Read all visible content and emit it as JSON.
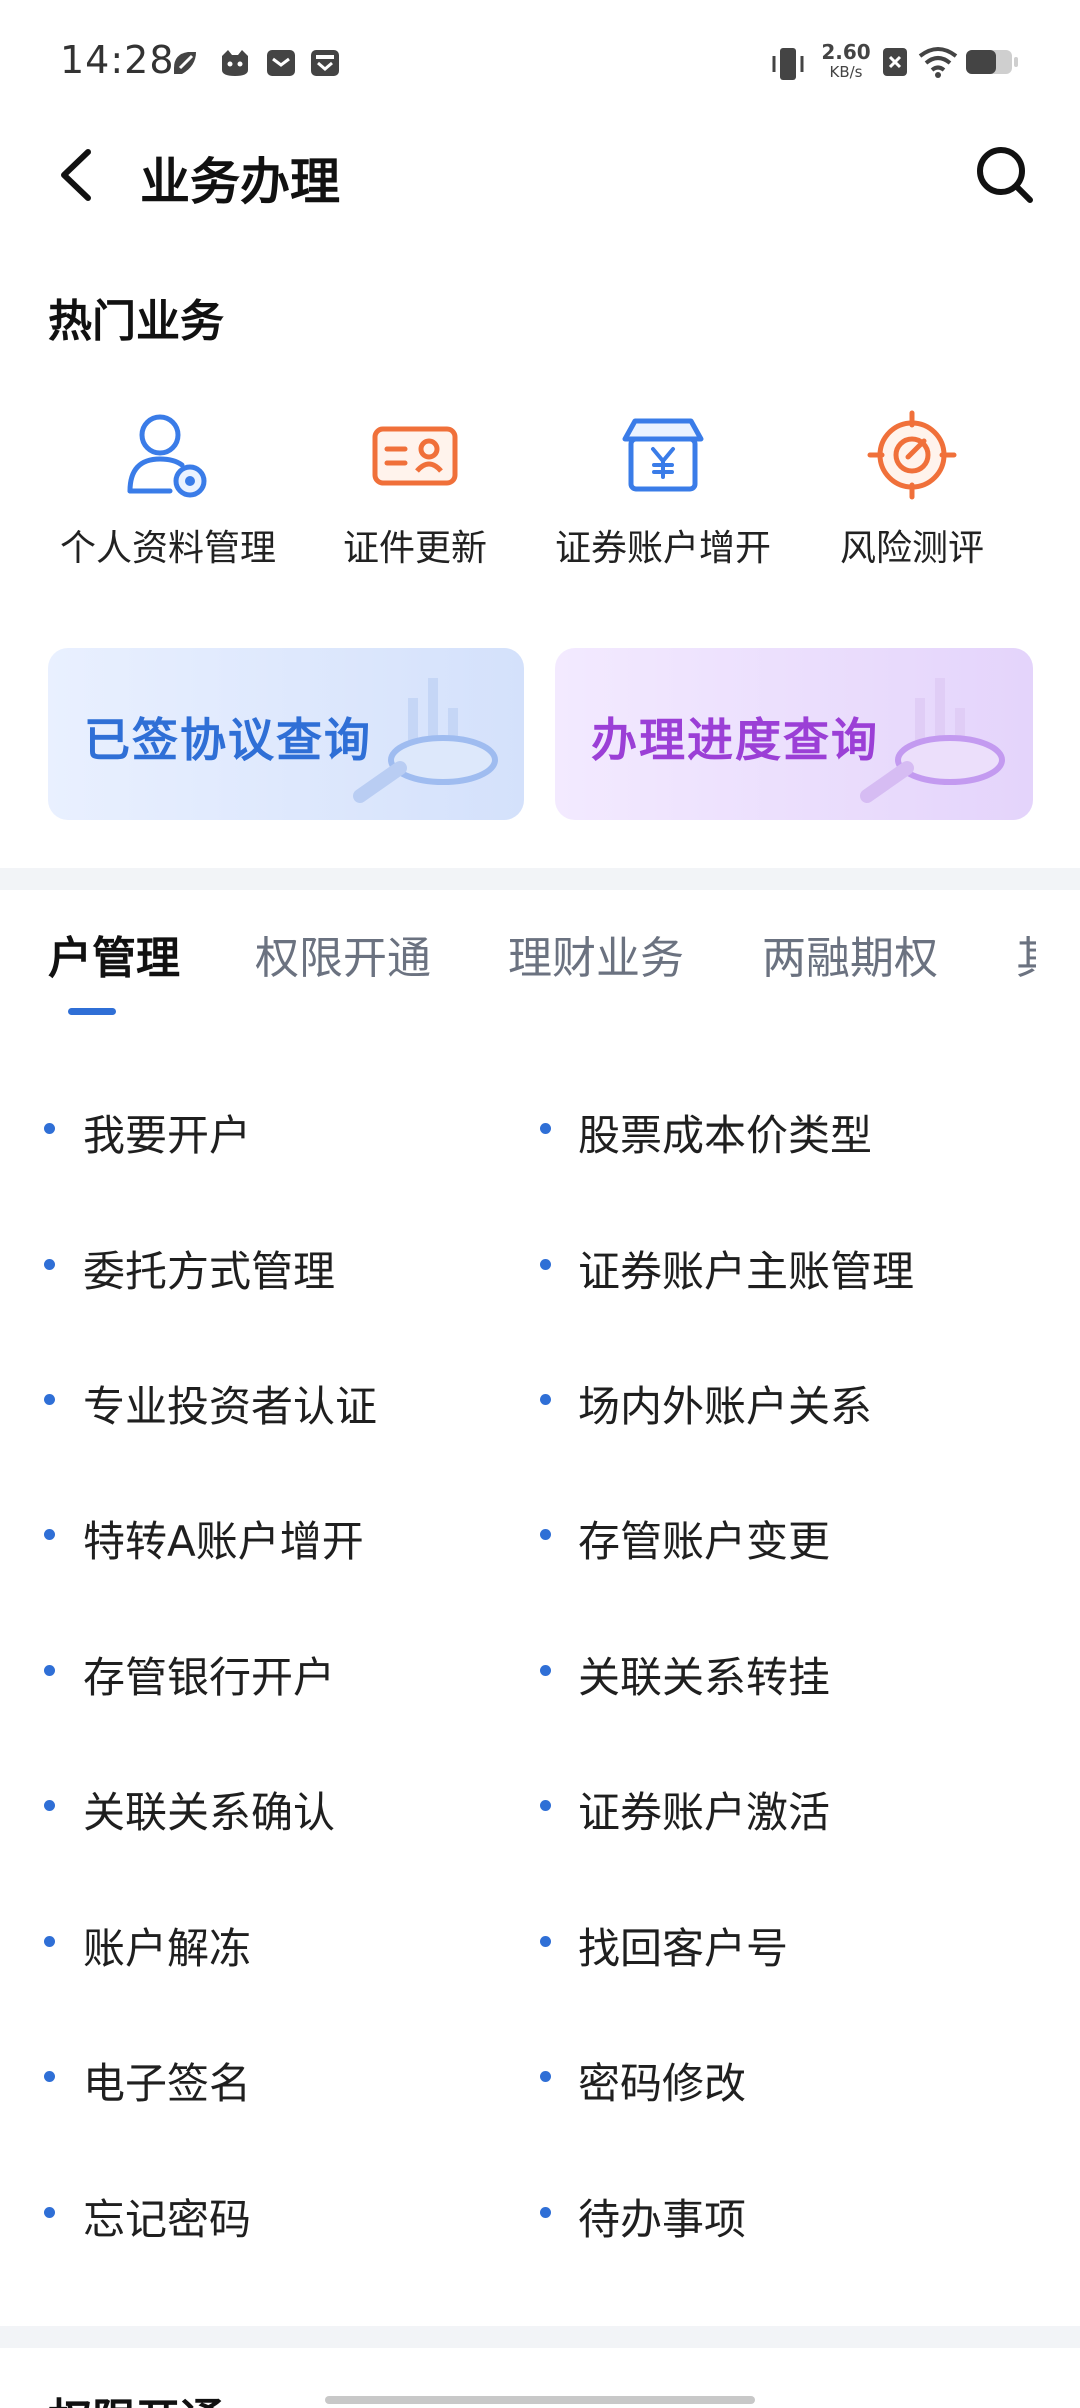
{
  "status_bar": {
    "time": "14:28",
    "speed_value": "2.60",
    "speed_unit": "KB/s",
    "left_icons": [
      "app-icon",
      "cat-icon",
      "mail-icon",
      "inbox-icon"
    ],
    "right_icons": [
      "vibrate-icon",
      "close-box-icon",
      "wifi-icon",
      "battery-icon"
    ]
  },
  "header": {
    "title": "业务办理",
    "back_icon": "chevron-left-icon",
    "search_icon": "search-icon"
  },
  "hot": {
    "title": "热门业务",
    "items": [
      {
        "label": "个人资料管理",
        "icon": "user-gear-icon",
        "color": "#3a7ce8"
      },
      {
        "label": "证件更新",
        "icon": "id-card-icon",
        "color": "#f0703a"
      },
      {
        "label": "证券账户增开",
        "icon": "yuan-box-icon",
        "color": "#3a7ce8"
      },
      {
        "label": "风险测评",
        "icon": "target-icon",
        "color": "#f0703a"
      }
    ]
  },
  "cards": [
    {
      "label": "已签协议查询",
      "icon": "magnifier-illustration",
      "color": "#2f6fd6"
    },
    {
      "label": "办理进度查询",
      "icon": "magnifier-illustration",
      "color": "#9b3fd6"
    }
  ],
  "tabs": [
    {
      "label": "户管理",
      "active": true
    },
    {
      "label": "权限开通",
      "active": false
    },
    {
      "label": "理财业务",
      "active": false
    },
    {
      "label": "两融期权",
      "active": false
    },
    {
      "label": "其",
      "active": false
    }
  ],
  "menu": {
    "left": [
      "我要开户",
      "委托方式管理",
      "专业投资者认证",
      "特转A账户增开",
      "存管银行开户",
      "关联关系确认",
      "账户解冻",
      "电子签名",
      "忘记密码"
    ],
    "right": [
      "股票成本价类型",
      "证券账户主账管理",
      "场内外账户关系",
      "存管账户变更",
      "关联关系转挂",
      "证券账户激活",
      "找回客户号",
      "密码修改",
      "待办事项"
    ]
  },
  "next_section": {
    "title": "权限开通"
  },
  "colors": {
    "accent_blue": "#2f6fd6",
    "accent_orange": "#f0703a",
    "accent_purple": "#9b3fd6",
    "band_gray": "#f2f4f7"
  }
}
